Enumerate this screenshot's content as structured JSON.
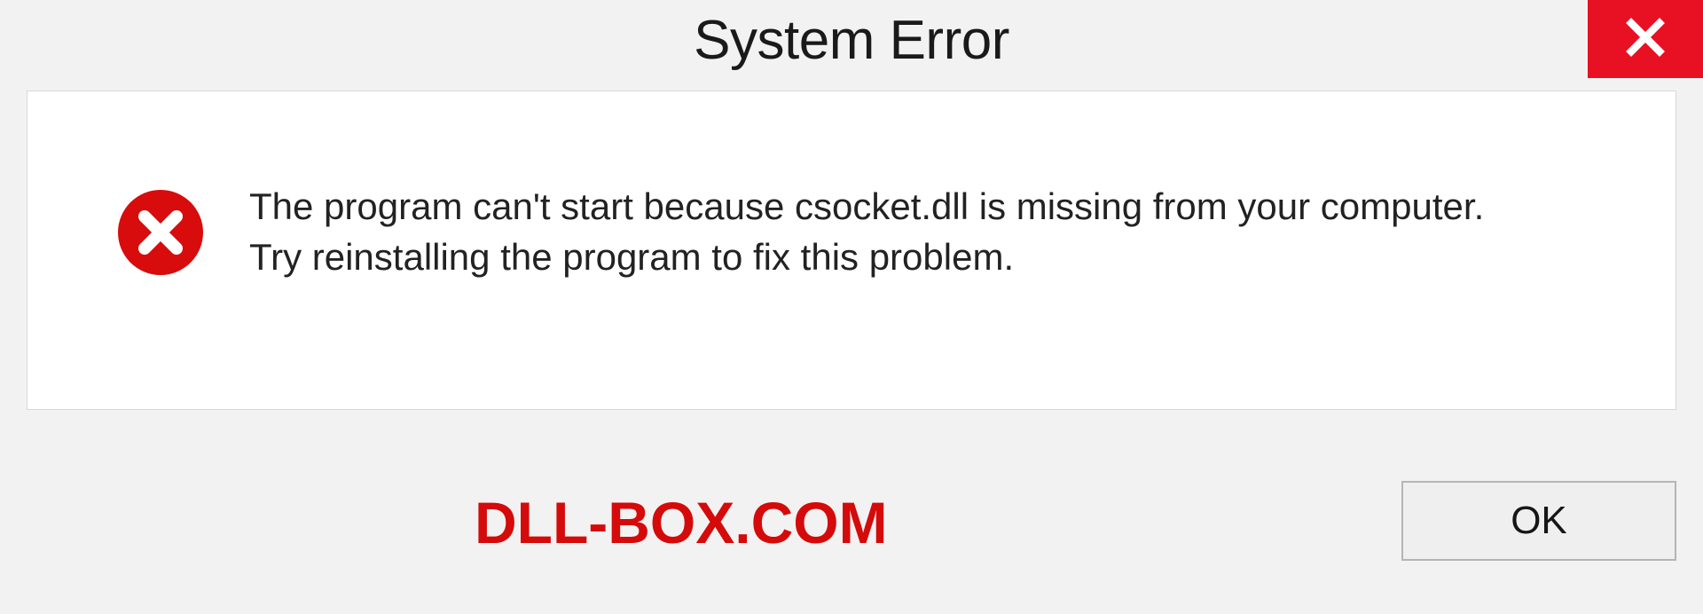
{
  "dialog": {
    "title": "System Error",
    "message_line1": "The program can't start because csocket.dll is missing from your computer.",
    "message_line2": "Try reinstalling the program to fix this problem.",
    "ok_label": "OK"
  },
  "watermark": "DLL-BOX.COM",
  "icons": {
    "close": "close-icon",
    "error": "error-circle-x-icon"
  },
  "colors": {
    "close_bg": "#e81123",
    "error_red": "#d80c0c",
    "watermark_red": "#d50a0a",
    "panel_bg": "#ffffff",
    "page_bg": "#f2f2f2"
  }
}
